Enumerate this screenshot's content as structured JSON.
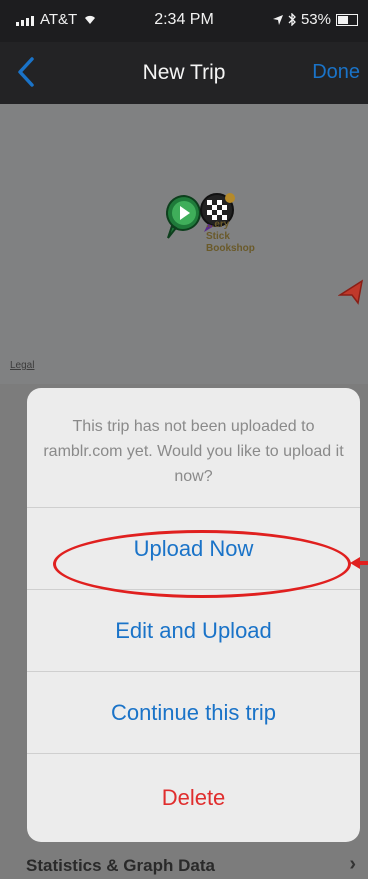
{
  "status_bar": {
    "carrier": "AT&T",
    "time": "2:34 PM",
    "battery": "53%"
  },
  "nav": {
    "title": "New Trip",
    "done_label": "Done"
  },
  "map": {
    "legal_label": "Legal",
    "poi_label_line1": "...ery",
    "poi_label_line2": "Stick",
    "poi_label_line3": "Bookshop"
  },
  "action_sheet": {
    "message": "This trip has not been uploaded to ramblr.com yet. Would you like to upload it now?",
    "actions": [
      {
        "label": "Upload Now"
      },
      {
        "label": "Edit and Upload"
      },
      {
        "label": "Continue this trip"
      },
      {
        "label": "Delete"
      }
    ]
  },
  "background": {
    "stats_label": "Statistics & Graph Data"
  },
  "colors": {
    "accent": "#1a73c8",
    "destructive": "#e02d2d",
    "annotation": "#e0201f"
  }
}
